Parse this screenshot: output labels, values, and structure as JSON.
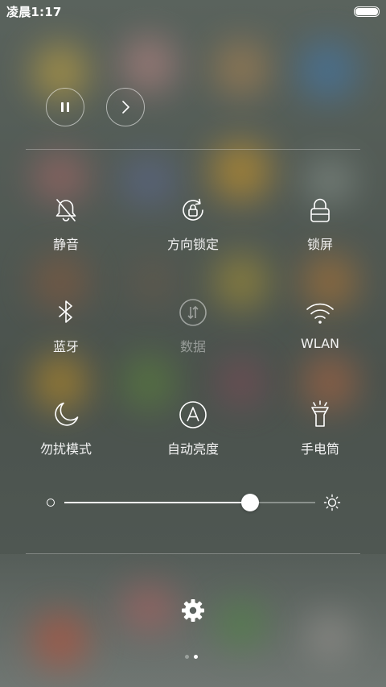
{
  "status_bar": {
    "time": "凌晨1:17",
    "battery_level": 1.0
  },
  "media": {
    "pause_icon": "pause-icon",
    "next_icon": "chevron-right-icon"
  },
  "toggles": [
    {
      "label": "静音",
      "icon": "bell-off-icon"
    },
    {
      "label": "方向锁定",
      "icon": "rotation-lock-icon"
    },
    {
      "label": "锁屏",
      "icon": "lock-icon"
    },
    {
      "label": "蓝牙",
      "icon": "bluetooth-icon"
    },
    {
      "label": "数据",
      "icon": "mobile-data-icon",
      "state": "off"
    },
    {
      "label": "WLAN",
      "icon": "wifi-icon"
    },
    {
      "label": "勿扰模式",
      "icon": "moon-icon"
    },
    {
      "label": "自动亮度",
      "icon": "auto-brightness-icon"
    },
    {
      "label": "手电筒",
      "icon": "flashlight-icon"
    }
  ],
  "brightness": {
    "level": 0.74,
    "min_icon": "brightness-low-icon",
    "max_icon": "brightness-high-icon"
  },
  "footer": {
    "settings_icon": "gear-icon",
    "page_count": 2,
    "active_page": 2
  },
  "colors": {
    "foreground": "#ffffff",
    "inactive_dot": "#9aa09c"
  }
}
